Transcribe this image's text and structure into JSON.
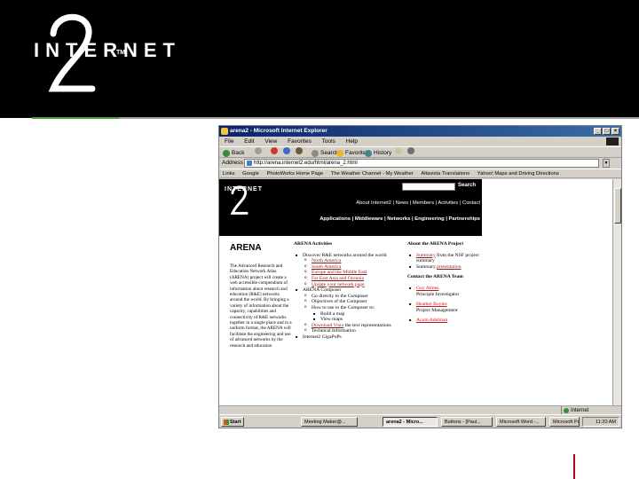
{
  "slide": {
    "logo_text": "INTERNET",
    "logo_tm": "TM",
    "colors": {
      "band": "#000000",
      "accent_green": "#4a9a3a",
      "accent_grey": "#9a9a9a",
      "footer_mark": "#b8001f"
    }
  },
  "browser": {
    "title": "arena2 - Microsoft Internet Explorer",
    "menu": [
      "File",
      "Edit",
      "View",
      "Favorites",
      "Tools",
      "Help"
    ],
    "toolbar": {
      "back": "Back",
      "search": "Search",
      "favorites": "Favorites",
      "history": "History"
    },
    "address": {
      "label": "Address",
      "url": "http://arena.internet2.edu/html/arena_2.html",
      "go": "→"
    },
    "links": [
      "Links",
      "Google",
      "PhotoWorks Home Page",
      "The Weather Channel - My Weather",
      "Altavista Translations",
      "Yahoo! Maps and Driving Directions"
    ],
    "status": {
      "zone": "Internet"
    }
  },
  "site": {
    "logo": "INTERNET",
    "search_label": "Search",
    "nav1": "About Internet2 | News | Members | Activities | Contact",
    "nav2": "Applications | Middleware | Networks | Engineering | Partnerships"
  },
  "arena": {
    "title": "ARENA",
    "intro": "The Advanced Research and Education Network Atlas (ARENA) project will create a web accessible compendium of information about research and education (R&E) networks around the world. By bringing a variety of information about the capacity, capabilities and connectivity of R&E networks together in a single place and in a uniform format, the ARENA will facilitate the engineering and use of advanced networks by the research and education",
    "activities": {
      "heading": "ARENA Activities",
      "discover": "Discover R&E networks around the world",
      "regions": [
        "North America",
        "South America",
        "Europe and the Middle East",
        "Far East Asia and Oceania",
        "Update your network page"
      ],
      "composer": "ARENA Composer",
      "composer_items": [
        "Go directly to the Composer",
        "Objectives of the Composer",
        "How to use to the Composer to:"
      ],
      "composer_sub": [
        "Build a map",
        "View maps"
      ],
      "download_link": "Download Visio",
      "download_rest": " the text representations",
      "technical": "Technical Information",
      "cutoff": "Internet2 GigaPoPs"
    },
    "about": {
      "heading": "About the ARENA Project",
      "summary_link": "Summary",
      "summary_rest": " from the NSF project summary",
      "presentation_prefix": "Summary ",
      "presentation_link": "presentation",
      "contact_heading": "Contact the ARENA Team",
      "contacts": [
        {
          "name": "Guy Almes",
          "role": "Principle Investigator"
        },
        {
          "name": "Heather Boyles",
          "role": "Project Management"
        },
        {
          "name": "Acom Adelman",
          "role": ""
        }
      ]
    }
  },
  "taskbar": {
    "start": "Start",
    "tasks": [
      "Meeting Maker@...",
      "arena2 - Micro...",
      "Buttons - [Paul...",
      "Microsoft Word -...",
      "Microsoft Power..."
    ],
    "clock": "11:20 AM"
  }
}
